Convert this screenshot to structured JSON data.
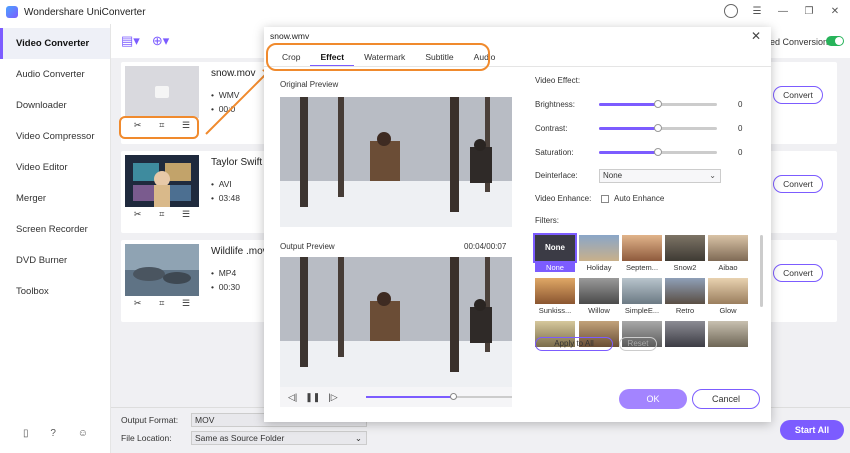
{
  "app": {
    "title": "Wondershare UniConverter"
  },
  "sidebar": {
    "items": [
      {
        "label": "Video Converter",
        "active": true
      },
      {
        "label": "Audio Converter"
      },
      {
        "label": "Downloader"
      },
      {
        "label": "Video Compressor"
      },
      {
        "label": "Video Editor"
      },
      {
        "label": "Merger"
      },
      {
        "label": "Screen Recorder"
      },
      {
        "label": "DVD Burner"
      },
      {
        "label": "Toolbox"
      }
    ]
  },
  "toolbar": {
    "high_speed_label": "ed Conversion"
  },
  "files": [
    {
      "name": "snow.mov",
      "format": "WMV",
      "duration": "00:0",
      "convert_label": "Convert"
    },
    {
      "name": "Taylor Swift -",
      "format": "AVI",
      "duration": "03:48",
      "convert_label": "Convert"
    },
    {
      "name": "Wildlife .mov",
      "format": "MP4",
      "duration": "00:30",
      "convert_label": "Convert"
    }
  ],
  "bottom": {
    "output_format_label": "Output Format:",
    "output_format_value": "MOV",
    "file_location_label": "File Location:",
    "file_location_value": "Same as Source Folder",
    "start_all_label": "Start All"
  },
  "dialog": {
    "title": "snow.wmv",
    "tabs": [
      {
        "label": "Crop"
      },
      {
        "label": "Effect",
        "active": true
      },
      {
        "label": "Watermark"
      },
      {
        "label": "Subtitle"
      },
      {
        "label": "Audio"
      }
    ],
    "original_preview_label": "Original Preview",
    "output_preview_label": "Output Preview",
    "timecode": "00:04/00:07",
    "video_effect_label": "Video Effect:",
    "brightness": {
      "label": "Brightness:",
      "value": "0",
      "fraction": 0.5
    },
    "contrast": {
      "label": "Contrast:",
      "value": "0",
      "fraction": 0.5
    },
    "saturation": {
      "label": "Saturation:",
      "value": "0",
      "fraction": 0.5
    },
    "deinterlace": {
      "label": "Deinterlace:",
      "value": "None"
    },
    "video_enhance": {
      "label": "Video Enhance:",
      "option": "Auto Enhance"
    },
    "filters_label": "Filters:",
    "filters": [
      {
        "name": "None",
        "selected": true
      },
      {
        "name": "Holiday"
      },
      {
        "name": "Septem..."
      },
      {
        "name": "Snow2"
      },
      {
        "name": "Aibao"
      },
      {
        "name": "Sunkiss..."
      },
      {
        "name": "Willow"
      },
      {
        "name": "SimpleE..."
      },
      {
        "name": "Retro"
      },
      {
        "name": "Glow"
      },
      {
        "name": ""
      },
      {
        "name": ""
      },
      {
        "name": ""
      },
      {
        "name": ""
      },
      {
        "name": ""
      }
    ],
    "none_tile_text": "None",
    "apply_all_label": "Apply to All",
    "reset_label": "Reset",
    "ok_label": "OK",
    "cancel_label": "Cancel",
    "playback_progress": 0.6
  }
}
